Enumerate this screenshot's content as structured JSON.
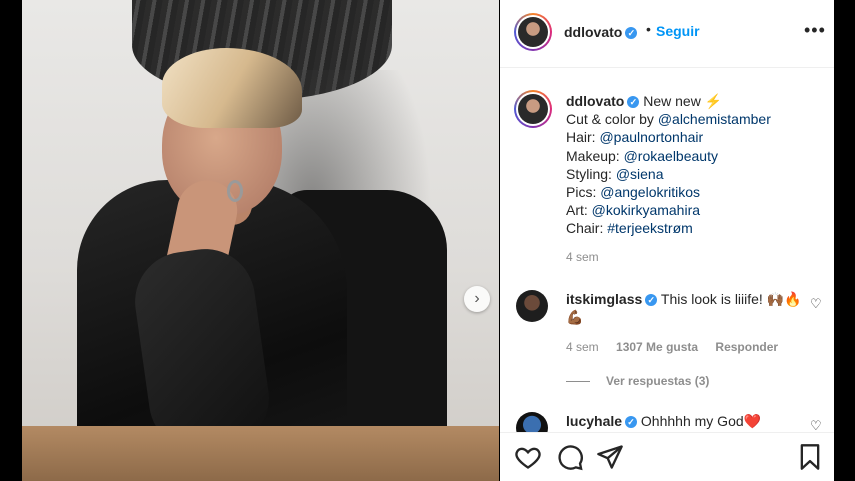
{
  "post": {
    "username": "ddlovato",
    "follow_label": "Seguir",
    "separator": "•",
    "more_label": "•••",
    "next_label": "›"
  },
  "caption": {
    "username": "ddlovato",
    "lines": [
      {
        "prefix": "New new ⚡",
        "mention": ""
      },
      {
        "prefix": "Cut & color by ",
        "mention": "@alchemistamber"
      },
      {
        "prefix": "Hair: ",
        "mention": "@paulnortonhair"
      },
      {
        "prefix": "Makeup: ",
        "mention": "@rokaelbeauty"
      },
      {
        "prefix": "Styling: ",
        "mention": "@siena"
      },
      {
        "prefix": "Pics: ",
        "mention": "@angelokritikos"
      },
      {
        "prefix": "Art: ",
        "mention": "@kokirkyamahira"
      },
      {
        "prefix": "Chair: ",
        "mention": "#terjeekstrøm"
      }
    ],
    "time": "4 sem"
  },
  "comments": [
    {
      "username": "itskimglass",
      "text": "This look is liiife! 🙌🏾🔥💪🏾",
      "time": "4 sem",
      "likes": "1307 Me gusta",
      "reply_label": "Responder",
      "view_replies": "Ver respuestas (3)"
    },
    {
      "username": "lucyhale",
      "text": "Ohhhhh my God❤️"
    }
  ],
  "icons": {
    "like": "heart-icon",
    "comment": "comment-icon",
    "share": "share-icon",
    "save": "bookmark-icon"
  },
  "colors": {
    "link_blue": "#0095f6",
    "mention_blue": "#00376b",
    "verified_blue": "#3897f0",
    "muted": "#8e8e8e"
  }
}
